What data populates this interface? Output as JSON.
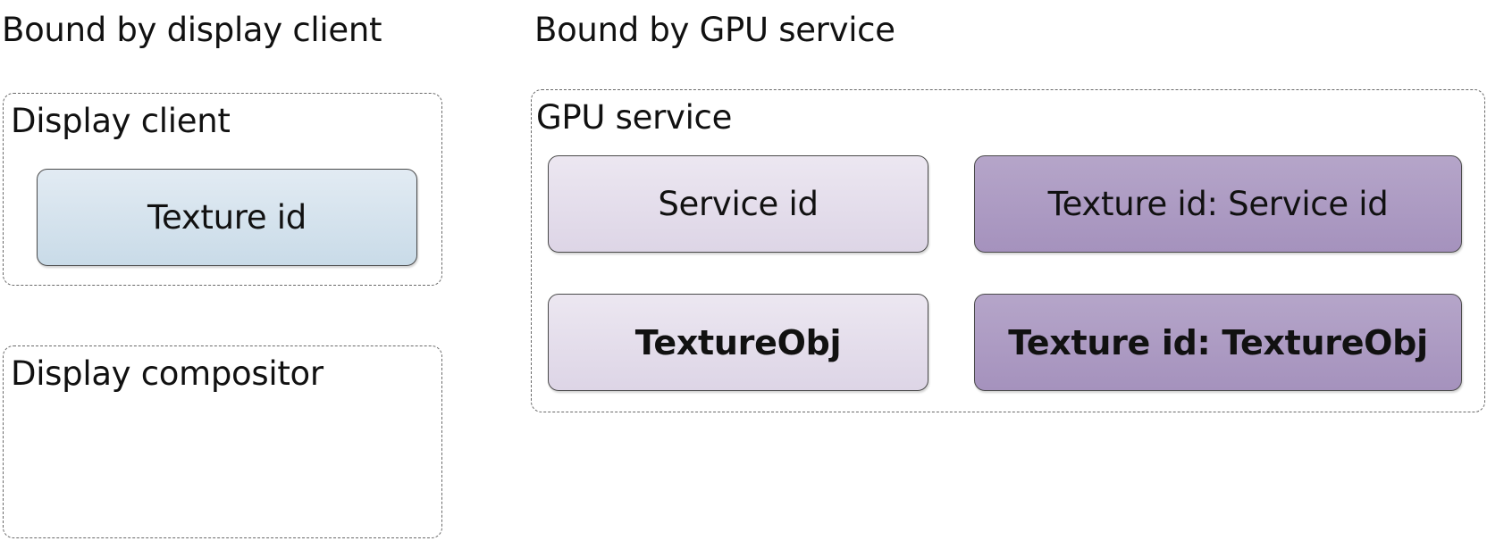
{
  "headings": {
    "left": "Bound by display client",
    "right": "Bound by GPU service"
  },
  "display_client": {
    "label": "Display client",
    "texture_id": "Texture id"
  },
  "display_compositor": {
    "label": "Display compositor"
  },
  "gpu_service": {
    "label": "GPU service",
    "service_id": "Service id",
    "texture_to_service": "Texture id: Service id",
    "texture_obj": "TextureObj",
    "texture_to_obj": "Texture id: TextureObj"
  },
  "colors": {
    "client_box": "#d3e1ec",
    "gpu_light_box": "#e3dcea",
    "gpu_dark_box": "#ab9ac3",
    "dashed_border": "#6a6a6a"
  }
}
